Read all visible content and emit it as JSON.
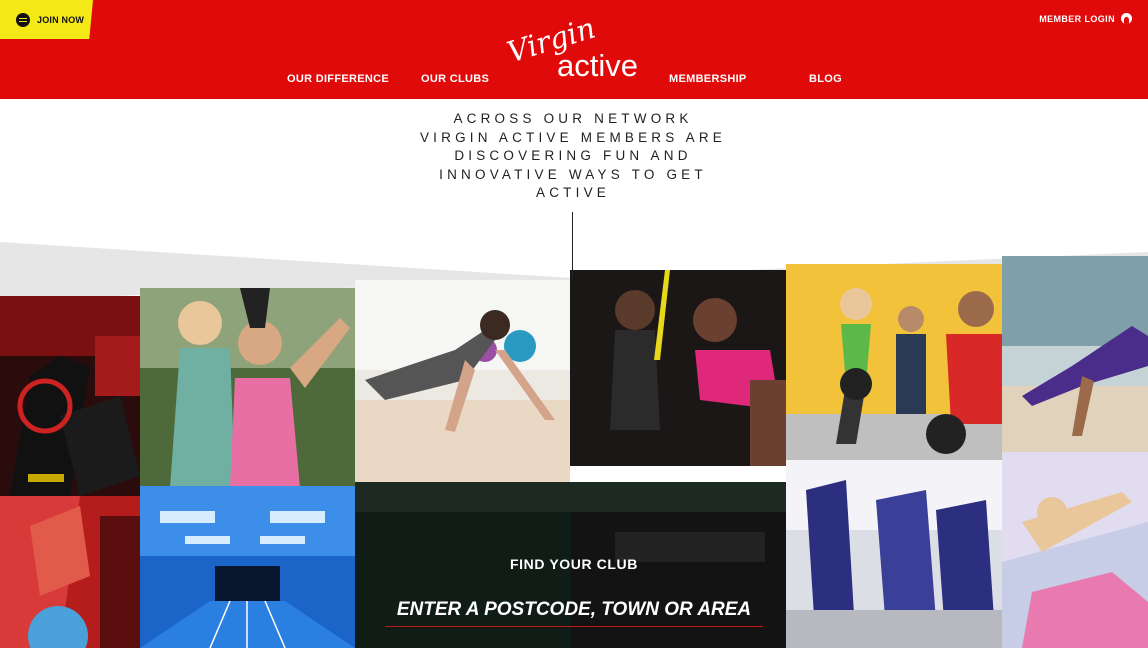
{
  "header": {
    "join_now": "JOIN NOW",
    "member_login": "MEMBER LOGIN",
    "logo": {
      "word1": "Virgin",
      "word2": "active"
    },
    "nav": [
      "OUR DIFFERENCE",
      "OUR CLUBS",
      "MEMBERSHIP",
      "BLOG"
    ]
  },
  "tagline": [
    "ACROSS OUR NETWORK",
    "VIRGIN ACTIVE MEMBERS ARE",
    "DISCOVERING FUN AND",
    "INNOVATIVE WAYS TO GET",
    "ACTIVE"
  ],
  "find_club": {
    "title": "FIND YOUR CLUB",
    "placeholder": "ENTER A POSTCODE, TOWN OR AREA"
  },
  "colors": {
    "brand_red": "#e10a0a",
    "join_yellow": "#f4e816"
  }
}
